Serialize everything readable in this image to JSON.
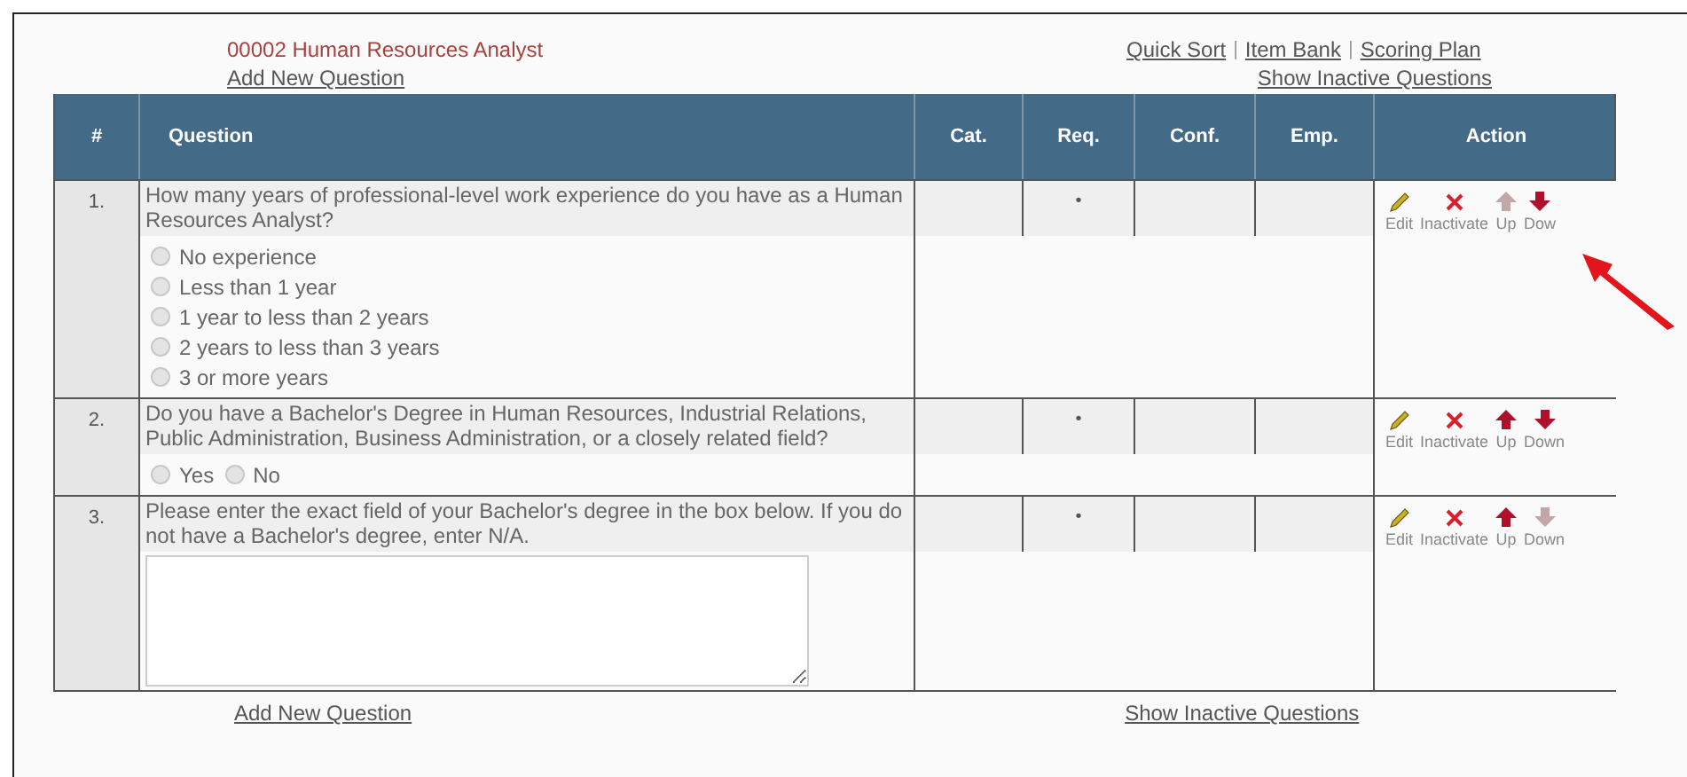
{
  "header": {
    "title": "00002 Human Resources Analyst",
    "add_link": "Add New Question",
    "nav_links": [
      "Quick Sort",
      "Item Bank",
      "Scoring Plan"
    ],
    "separator": "|",
    "inactive_link": "Show Inactive Questions"
  },
  "table": {
    "columns": [
      "#",
      "Question",
      "Cat.",
      "Req.",
      "Conf.",
      "Emp.",
      "Action"
    ],
    "rows": [
      {
        "number": "1.",
        "question": "How many years of professional-level work experience do you have as a Human Resources Analyst?",
        "req": "•",
        "answer": {
          "kind": "radio-list",
          "options": [
            {
              "label": "No experience",
              "checked": false
            },
            {
              "label": "Less than 1 year",
              "checked": false
            },
            {
              "label": "1 year to less than 2 years",
              "checked": false
            },
            {
              "label": "2 years to less than 3 years",
              "checked": false
            },
            {
              "label": "3 or more years",
              "checked": false
            }
          ]
        },
        "actions": {
          "edit": "Edit",
          "inactivate": "Inactivate",
          "up": "Up",
          "down": "Dow",
          "up_disabled": true,
          "down_disabled": false
        }
      },
      {
        "number": "2.",
        "question": "Do you have a Bachelor's Degree in Human Resources, Industrial Relations, Public Administration, Business Administration, or a closely related field?",
        "req": "•",
        "answer": {
          "kind": "radio-inline",
          "options": [
            {
              "label": "Yes",
              "checked": false
            },
            {
              "label": "No",
              "checked": false
            }
          ]
        },
        "actions": {
          "edit": "Edit",
          "inactivate": "Inactivate",
          "up": "Up",
          "down": "Down",
          "up_disabled": false,
          "down_disabled": false
        }
      },
      {
        "number": "3.",
        "question": "Please enter the exact field of your Bachelor's degree in the box below. If you do not have a Bachelor's degree, enter N/A.",
        "req": "•",
        "answer": {
          "kind": "textarea"
        },
        "actions": {
          "edit": "Edit",
          "inactivate": "Inactivate",
          "up": "Up",
          "down": "Down",
          "up_disabled": false,
          "down_disabled": true
        }
      }
    ]
  },
  "footer": {
    "add_link": "Add New Question",
    "inactive_link": "Show Inactive Questions"
  },
  "annotation": {
    "kind": "arrow"
  }
}
